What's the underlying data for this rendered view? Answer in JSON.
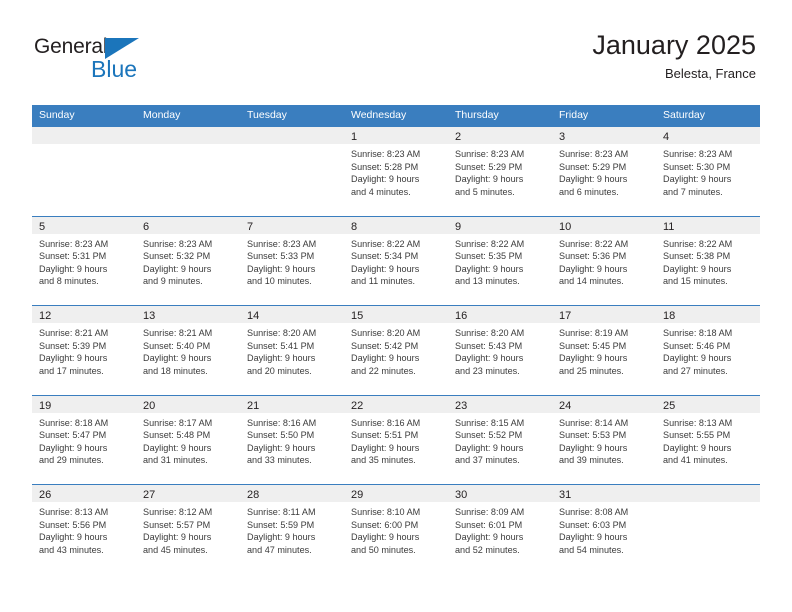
{
  "brand": {
    "name_part1": "General",
    "name_part2": "Blue",
    "accent_color": "#1b75bb",
    "triangle_icon": "triangle-icon"
  },
  "header": {
    "title": "January 2025",
    "subtitle": "Belesta, France"
  },
  "calendar": {
    "header_bg": "#3a7ebf",
    "day_band_bg": "#efefef",
    "weekday_names": [
      "Sunday",
      "Monday",
      "Tuesday",
      "Wednesday",
      "Thursday",
      "Friday",
      "Saturday"
    ],
    "weeks": [
      [
        {
          "day": "",
          "empty": true,
          "lines": []
        },
        {
          "day": "",
          "empty": true,
          "lines": []
        },
        {
          "day": "",
          "empty": true,
          "lines": []
        },
        {
          "day": "1",
          "empty": false,
          "lines": [
            "Sunrise: 8:23 AM",
            "Sunset: 5:28 PM",
            "Daylight: 9 hours",
            "and 4 minutes."
          ]
        },
        {
          "day": "2",
          "empty": false,
          "lines": [
            "Sunrise: 8:23 AM",
            "Sunset: 5:29 PM",
            "Daylight: 9 hours",
            "and 5 minutes."
          ]
        },
        {
          "day": "3",
          "empty": false,
          "lines": [
            "Sunrise: 8:23 AM",
            "Sunset: 5:29 PM",
            "Daylight: 9 hours",
            "and 6 minutes."
          ]
        },
        {
          "day": "4",
          "empty": false,
          "lines": [
            "Sunrise: 8:23 AM",
            "Sunset: 5:30 PM",
            "Daylight: 9 hours",
            "and 7 minutes."
          ]
        }
      ],
      [
        {
          "day": "5",
          "empty": false,
          "lines": [
            "Sunrise: 8:23 AM",
            "Sunset: 5:31 PM",
            "Daylight: 9 hours",
            "and 8 minutes."
          ]
        },
        {
          "day": "6",
          "empty": false,
          "lines": [
            "Sunrise: 8:23 AM",
            "Sunset: 5:32 PM",
            "Daylight: 9 hours",
            "and 9 minutes."
          ]
        },
        {
          "day": "7",
          "empty": false,
          "lines": [
            "Sunrise: 8:23 AM",
            "Sunset: 5:33 PM",
            "Daylight: 9 hours",
            "and 10 minutes."
          ]
        },
        {
          "day": "8",
          "empty": false,
          "lines": [
            "Sunrise: 8:22 AM",
            "Sunset: 5:34 PM",
            "Daylight: 9 hours",
            "and 11 minutes."
          ]
        },
        {
          "day": "9",
          "empty": false,
          "lines": [
            "Sunrise: 8:22 AM",
            "Sunset: 5:35 PM",
            "Daylight: 9 hours",
            "and 13 minutes."
          ]
        },
        {
          "day": "10",
          "empty": false,
          "lines": [
            "Sunrise: 8:22 AM",
            "Sunset: 5:36 PM",
            "Daylight: 9 hours",
            "and 14 minutes."
          ]
        },
        {
          "day": "11",
          "empty": false,
          "lines": [
            "Sunrise: 8:22 AM",
            "Sunset: 5:38 PM",
            "Daylight: 9 hours",
            "and 15 minutes."
          ]
        }
      ],
      [
        {
          "day": "12",
          "empty": false,
          "lines": [
            "Sunrise: 8:21 AM",
            "Sunset: 5:39 PM",
            "Daylight: 9 hours",
            "and 17 minutes."
          ]
        },
        {
          "day": "13",
          "empty": false,
          "lines": [
            "Sunrise: 8:21 AM",
            "Sunset: 5:40 PM",
            "Daylight: 9 hours",
            "and 18 minutes."
          ]
        },
        {
          "day": "14",
          "empty": false,
          "lines": [
            "Sunrise: 8:20 AM",
            "Sunset: 5:41 PM",
            "Daylight: 9 hours",
            "and 20 minutes."
          ]
        },
        {
          "day": "15",
          "empty": false,
          "lines": [
            "Sunrise: 8:20 AM",
            "Sunset: 5:42 PM",
            "Daylight: 9 hours",
            "and 22 minutes."
          ]
        },
        {
          "day": "16",
          "empty": false,
          "lines": [
            "Sunrise: 8:20 AM",
            "Sunset: 5:43 PM",
            "Daylight: 9 hours",
            "and 23 minutes."
          ]
        },
        {
          "day": "17",
          "empty": false,
          "lines": [
            "Sunrise: 8:19 AM",
            "Sunset: 5:45 PM",
            "Daylight: 9 hours",
            "and 25 minutes."
          ]
        },
        {
          "day": "18",
          "empty": false,
          "lines": [
            "Sunrise: 8:18 AM",
            "Sunset: 5:46 PM",
            "Daylight: 9 hours",
            "and 27 minutes."
          ]
        }
      ],
      [
        {
          "day": "19",
          "empty": false,
          "lines": [
            "Sunrise: 8:18 AM",
            "Sunset: 5:47 PM",
            "Daylight: 9 hours",
            "and 29 minutes."
          ]
        },
        {
          "day": "20",
          "empty": false,
          "lines": [
            "Sunrise: 8:17 AM",
            "Sunset: 5:48 PM",
            "Daylight: 9 hours",
            "and 31 minutes."
          ]
        },
        {
          "day": "21",
          "empty": false,
          "lines": [
            "Sunrise: 8:16 AM",
            "Sunset: 5:50 PM",
            "Daylight: 9 hours",
            "and 33 minutes."
          ]
        },
        {
          "day": "22",
          "empty": false,
          "lines": [
            "Sunrise: 8:16 AM",
            "Sunset: 5:51 PM",
            "Daylight: 9 hours",
            "and 35 minutes."
          ]
        },
        {
          "day": "23",
          "empty": false,
          "lines": [
            "Sunrise: 8:15 AM",
            "Sunset: 5:52 PM",
            "Daylight: 9 hours",
            "and 37 minutes."
          ]
        },
        {
          "day": "24",
          "empty": false,
          "lines": [
            "Sunrise: 8:14 AM",
            "Sunset: 5:53 PM",
            "Daylight: 9 hours",
            "and 39 minutes."
          ]
        },
        {
          "day": "25",
          "empty": false,
          "lines": [
            "Sunrise: 8:13 AM",
            "Sunset: 5:55 PM",
            "Daylight: 9 hours",
            "and 41 minutes."
          ]
        }
      ],
      [
        {
          "day": "26",
          "empty": false,
          "lines": [
            "Sunrise: 8:13 AM",
            "Sunset: 5:56 PM",
            "Daylight: 9 hours",
            "and 43 minutes."
          ]
        },
        {
          "day": "27",
          "empty": false,
          "lines": [
            "Sunrise: 8:12 AM",
            "Sunset: 5:57 PM",
            "Daylight: 9 hours",
            "and 45 minutes."
          ]
        },
        {
          "day": "28",
          "empty": false,
          "lines": [
            "Sunrise: 8:11 AM",
            "Sunset: 5:59 PM",
            "Daylight: 9 hours",
            "and 47 minutes."
          ]
        },
        {
          "day": "29",
          "empty": false,
          "lines": [
            "Sunrise: 8:10 AM",
            "Sunset: 6:00 PM",
            "Daylight: 9 hours",
            "and 50 minutes."
          ]
        },
        {
          "day": "30",
          "empty": false,
          "lines": [
            "Sunrise: 8:09 AM",
            "Sunset: 6:01 PM",
            "Daylight: 9 hours",
            "and 52 minutes."
          ]
        },
        {
          "day": "31",
          "empty": false,
          "lines": [
            "Sunrise: 8:08 AM",
            "Sunset: 6:03 PM",
            "Daylight: 9 hours",
            "and 54 minutes."
          ]
        },
        {
          "day": "",
          "empty": true,
          "lines": []
        }
      ]
    ]
  }
}
